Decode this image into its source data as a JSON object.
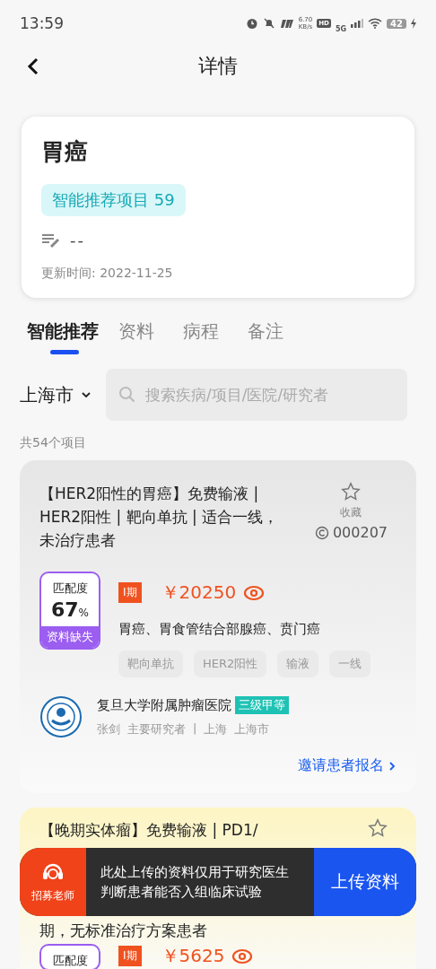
{
  "status_bar": {
    "time": "13:59",
    "speed": "6.70",
    "speed_unit": "KB/s",
    "hd": "HD",
    "network": "5G",
    "battery": "42"
  },
  "header": {
    "title": "详情"
  },
  "summary": {
    "title": "胃癌",
    "badge": "智能推荐项目 59",
    "note": "--",
    "updated": "更新时间: 2022-11-25"
  },
  "tabs": [
    {
      "label": "智能推荐",
      "selected": true
    },
    {
      "label": "资料",
      "selected": false
    },
    {
      "label": "病程",
      "selected": false
    },
    {
      "label": "备注",
      "selected": false
    }
  ],
  "filter": {
    "city": "上海市",
    "search_placeholder": "搜索疾病/项目/医院/研究者"
  },
  "count": "共54个项目",
  "projects": [
    {
      "color": "#e6e6e6",
      "title_lines": [
        "【HER2阳性的胃癌】免费输液 |",
        "HER2阳性 | 靶向单抗 | 适合一线，",
        "未治疗患者"
      ],
      "favorite": "收藏",
      "favorited": false,
      "code": "000207",
      "match_label": "匹配度",
      "match": "67",
      "match_unit": "%",
      "match_note": "资料缺失",
      "phase": "I期",
      "price": "￥20250",
      "diseases": "胃癌、胃食管结合部腺癌、贲门癌",
      "tags": [
        "靶向单抗",
        "HER2阳性",
        "输液",
        "一线"
      ],
      "hospital": "复旦大学附属肿瘤医院",
      "hospital_level": "三级甲等",
      "investigator": "张剑",
      "role": "主要研究者",
      "separator": "|",
      "province": "上海",
      "city": "上海市",
      "invite": "邀请患者报名"
    },
    {
      "color": "#fdf5c4",
      "title_lines": [
        "【晚期实体瘤】免费输液 | PD1/",
        "期，无标准治疗方案患者"
      ],
      "favorited": false,
      "match_label": "匹配度",
      "phase": "I期",
      "price": "￥5625"
    }
  ],
  "upload_bar": {
    "recruiter": "招募老师",
    "message": "此处上传的资料仅用于研究医生判断患者能否入组临床试验",
    "button": "上传资料"
  }
}
